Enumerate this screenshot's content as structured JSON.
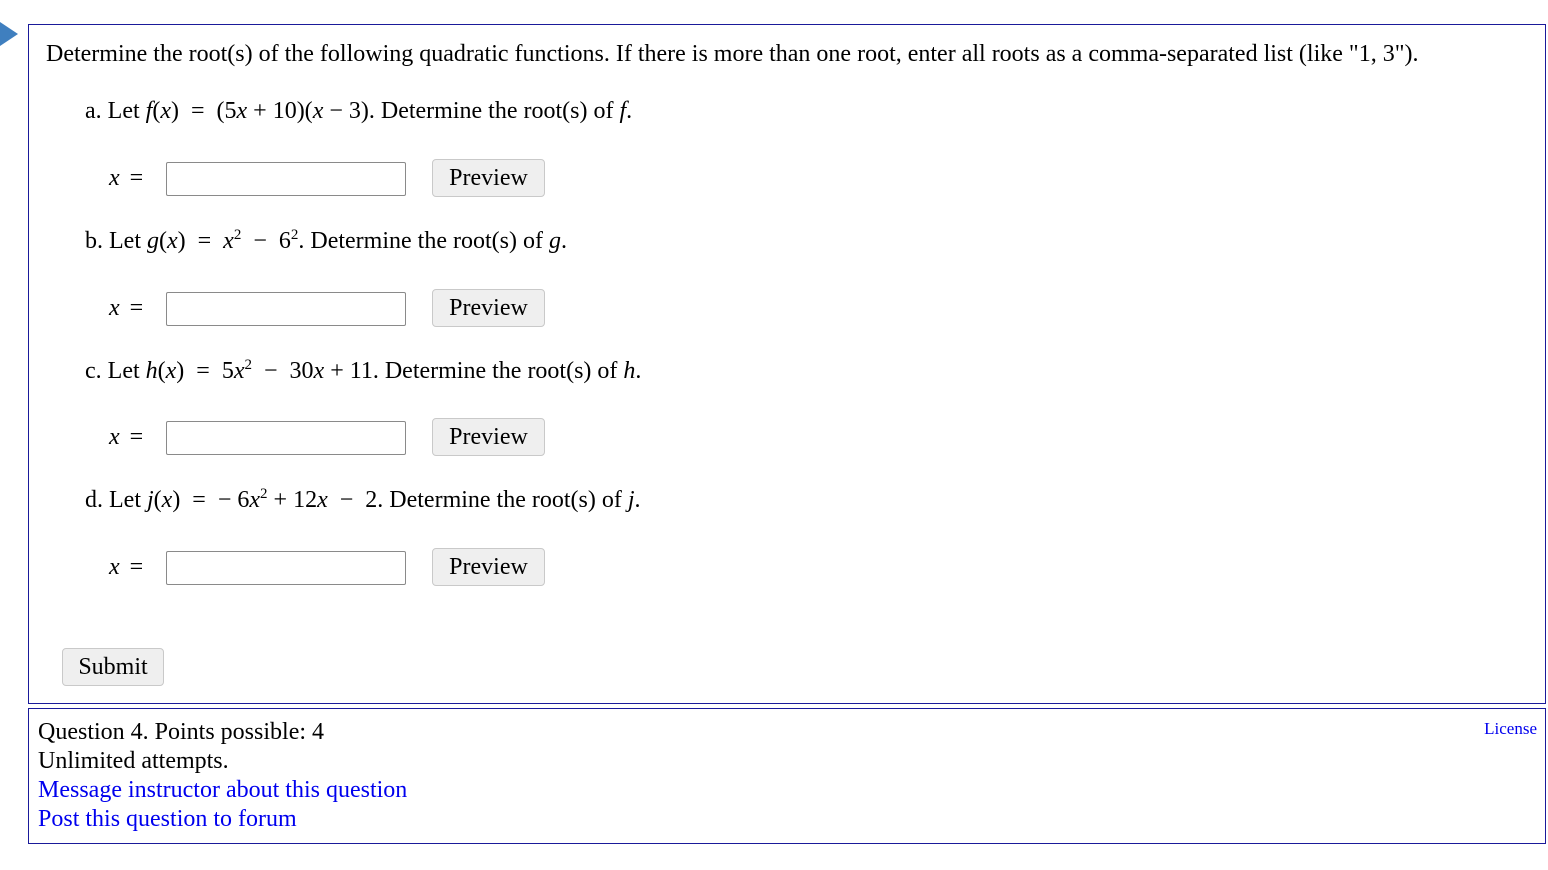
{
  "question": {
    "intro": "Determine the root(s) of the following quadratic functions. If there is more than one root, enter all roots as a comma-separated list (like \"1, 3\").",
    "answer_label": "x",
    "answer_eq": "=",
    "preview_label": "Preview",
    "submit_label": "Submit",
    "parts": [
      {
        "letter": "a.",
        "lead": "Let",
        "fn": "f",
        "expr_a": "(5",
        "expr_b": " + 10)(",
        "expr_c": " − 3). Determine the root(s) of ",
        "answer_value": ""
      },
      {
        "letter": "b.",
        "lead": "Let",
        "fn": "g",
        "answer_value": ""
      },
      {
        "letter": "c.",
        "lead": "Let",
        "fn": "h",
        "answer_value": ""
      },
      {
        "letter": "d.",
        "lead": "Let",
        "fn": "j",
        "answer_value": ""
      }
    ]
  },
  "info": {
    "line1": "Question 4. Points possible: 4",
    "line2": "Unlimited attempts.",
    "message_link": "Message instructor about this question",
    "forum_link": "Post this question to forum",
    "license_link": "License"
  },
  "colors": {
    "border": "#1a1a9a",
    "link": "#0000ee",
    "arrow": "#3f7fbf"
  }
}
